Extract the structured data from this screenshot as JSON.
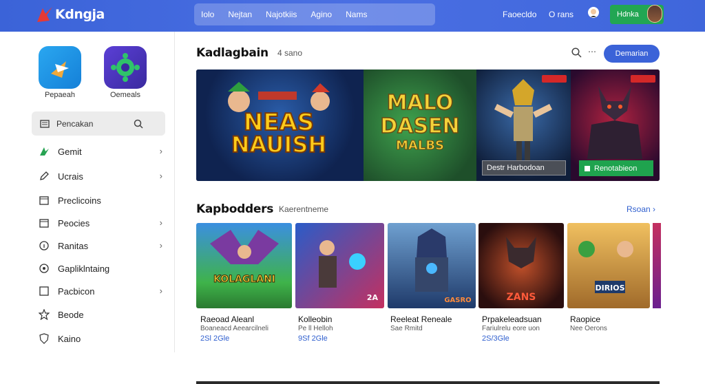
{
  "header": {
    "logo_text": "Kdngja",
    "nav": [
      "Iolo",
      "Nejtan",
      "Najotkiis",
      "Agino",
      "Nams"
    ],
    "link_1": "Faoecldo",
    "link_2": "O rans",
    "button_label": "Hdnka"
  },
  "sidebar": {
    "apps": [
      {
        "label": "Pepaeah"
      },
      {
        "label": "Oemeals"
      }
    ],
    "search_label": "Pencakan",
    "items": [
      {
        "label": "Gemit",
        "icon": "gamepad-icon",
        "chevron": true
      },
      {
        "label": "Ucrais",
        "icon": "pencil-icon",
        "chevron": true
      },
      {
        "label": "Preclicoins",
        "icon": "calendar-icon",
        "chevron": false
      },
      {
        "label": "Peocies",
        "icon": "calendar-icon",
        "chevron": true
      },
      {
        "label": "Ranitas",
        "icon": "info-icon",
        "chevron": true
      },
      {
        "label": "Gapliklntaing",
        "icon": "circle-icon",
        "chevron": false
      },
      {
        "label": "Pacbicon",
        "icon": "square-icon",
        "chevron": true
      },
      {
        "label": "Beode",
        "icon": "star-icon",
        "chevron": false
      },
      {
        "label": "Kaino",
        "icon": "shield-icon",
        "chevron": false
      }
    ]
  },
  "featured": {
    "title": "Kadlagbain",
    "subtitle": "4 sano",
    "button_label": "Demarian",
    "panels": [
      {
        "title_line1": "NEAS",
        "title_line2": "NAUISH"
      },
      {
        "title_line1": "MALO",
        "title_line2": "DASEN",
        "title_line3": "MALBS"
      },
      {
        "art": "knight"
      },
      {
        "art": "demon"
      }
    ],
    "gray_button": "Destr  Harbodoan",
    "green_button": "Renotabieon"
  },
  "section2": {
    "title": "Kapbodders",
    "subtitle": "Kaerentneme",
    "see_all": "Rsoan"
  },
  "cards": [
    {
      "name": "Raeoad Aleanl",
      "dev": "Boaneacd Aeearcilneli",
      "price": "2Sl 2Gle",
      "art_text": "KOLAGLANI"
    },
    {
      "name": "Kolleobin",
      "dev": "Pe ll Helloh",
      "price": "9Sf 2Gle",
      "art_text": "2A"
    },
    {
      "name": "Reeleat Reneale",
      "dev": "Sae Rmitd",
      "price": "",
      "art_text": "GASRO"
    },
    {
      "name": "Prpakeleadsuan",
      "dev": "Fariulrelu eore uon",
      "price": "2S/3Gle",
      "art_text": "ZANS"
    },
    {
      "name": "Raopice",
      "dev": "Nee Oerons",
      "price": "",
      "art_text": "DIRIOS"
    }
  ]
}
